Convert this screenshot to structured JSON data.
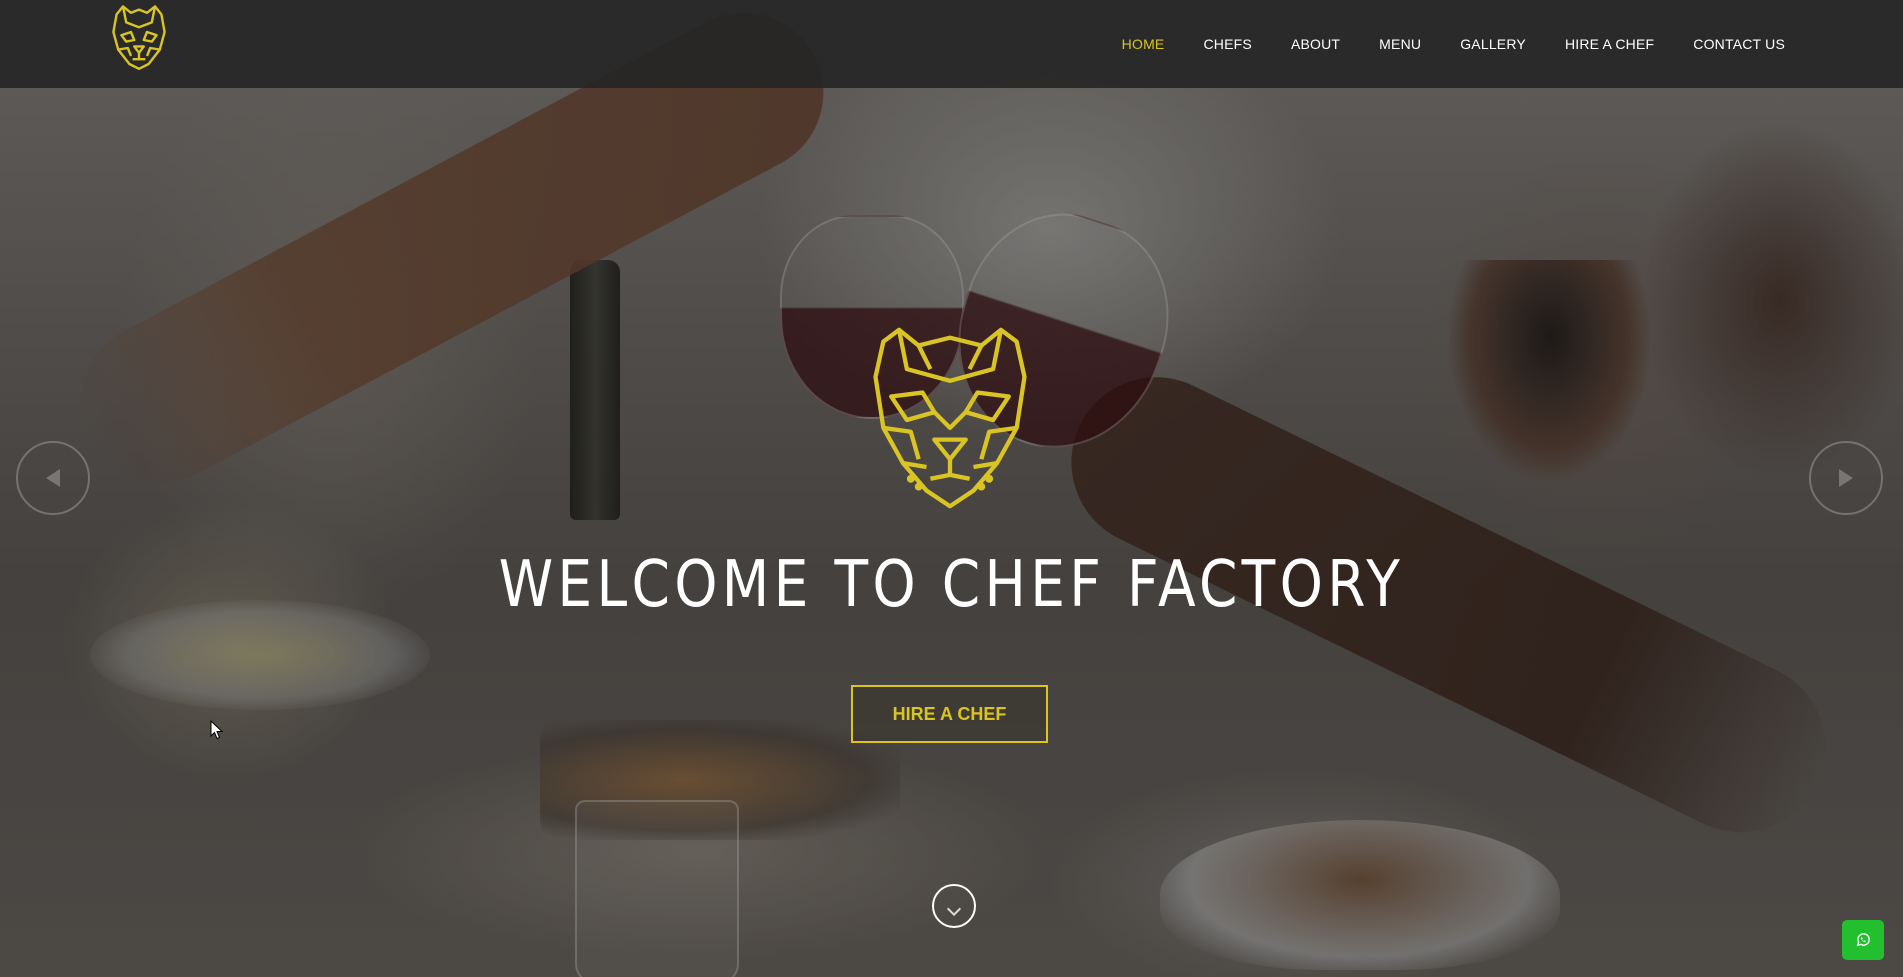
{
  "nav": {
    "items": [
      {
        "label": "HOME",
        "active": true
      },
      {
        "label": "CHEFS",
        "active": false
      },
      {
        "label": "ABOUT",
        "active": false
      },
      {
        "label": "MENU",
        "active": false
      },
      {
        "label": "GALLERY",
        "active": false
      },
      {
        "label": "HIRE A CHEF",
        "active": false
      },
      {
        "label": "CONTACT US",
        "active": false
      }
    ]
  },
  "hero": {
    "title": "WELCOME TO CHEF FACTORY",
    "cta_label": "HIRE A CHEF"
  },
  "icons": {
    "logo": "tiger-logo",
    "hero_logo": "tiger-logo",
    "prev": "arrow-left-icon",
    "next": "arrow-right-icon",
    "scroll": "chevron-down-icon",
    "whatsapp": "whatsapp-icon"
  },
  "colors": {
    "accent": "#d9c423",
    "navbar": "#262626",
    "whatsapp": "#22c02e",
    "text": "#ffffff"
  }
}
